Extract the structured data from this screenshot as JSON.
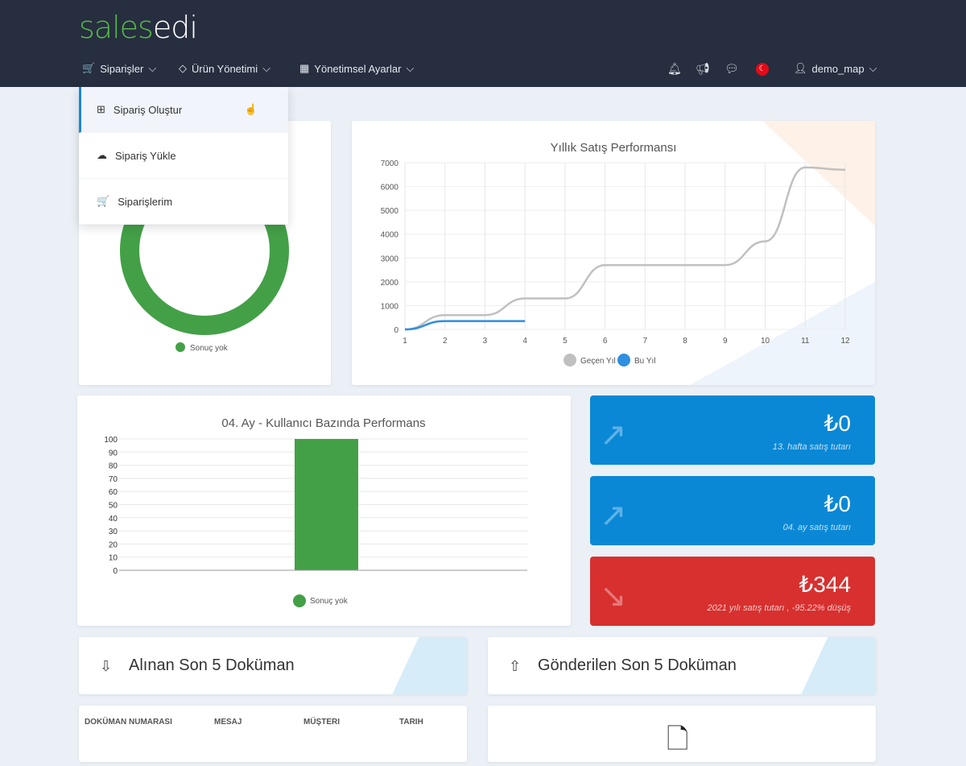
{
  "brand": {
    "part1": "sales",
    "part2": "edi"
  },
  "nav": {
    "menus": [
      {
        "label": "Siparişler",
        "icon": "cart-icon"
      },
      {
        "label": "Ürün Yönetimi",
        "icon": "tag-icon"
      },
      {
        "label": "Yönetimsel Ayarlar",
        "icon": "building-icon"
      }
    ],
    "user": "demo_map",
    "flag": "☾"
  },
  "dropdown": {
    "items": [
      {
        "label": "Sipariş Oluştur",
        "icon": "add-document-icon"
      },
      {
        "label": "Sipariş Yükle",
        "icon": "cloud-upload-icon"
      },
      {
        "label": "Siparişlerim",
        "icon": "cart-icon"
      }
    ]
  },
  "donut": {
    "legend": "Sonuç yok",
    "color": "#43a047"
  },
  "chart_data": [
    {
      "type": "line",
      "title": "Yıllık Satış Performansı",
      "x": [
        1,
        2,
        3,
        4,
        5,
        6,
        7,
        8,
        9,
        10,
        11,
        12
      ],
      "ylim": [
        0,
        7000
      ],
      "yticks": [
        0,
        1000,
        2000,
        3000,
        4000,
        5000,
        6000,
        7000
      ],
      "series": [
        {
          "name": "Geçen Yıl",
          "color": "#c0c0c0",
          "values": [
            0,
            600,
            600,
            1300,
            1300,
            2700,
            2700,
            2700,
            2700,
            3700,
            6800,
            6700
          ]
        },
        {
          "name": "Bu Yıl",
          "color": "#2f8fe0",
          "values": [
            0,
            350,
            350,
            350
          ]
        }
      ]
    },
    {
      "type": "bar",
      "title": "04. Ay -  Kullanıcı Bazında Performans",
      "categories": [
        ""
      ],
      "values": [
        100
      ],
      "ylim": [
        0,
        100
      ],
      "yticks": [
        0,
        10,
        20,
        30,
        40,
        50,
        60,
        70,
        80,
        90,
        100
      ],
      "legend": "Sonuç yok",
      "color": "#43a047"
    }
  ],
  "stats": [
    {
      "value": "₺0",
      "label": "13. hafta satış tutarı"
    },
    {
      "value": "₺0",
      "label": "04. ay satış tutarı"
    },
    {
      "value": "₺344",
      "label": "2021 yılı satış tutarı , -95.22% düşüş"
    }
  ],
  "docs": {
    "received": "Alınan Son 5 Doküman",
    "sent": "Gönderilen Son 5 Doküman",
    "columns": [
      "DOKÜMAN NUMARASI",
      "MESAJ",
      "MÜŞTERI",
      "TARIH"
    ]
  }
}
